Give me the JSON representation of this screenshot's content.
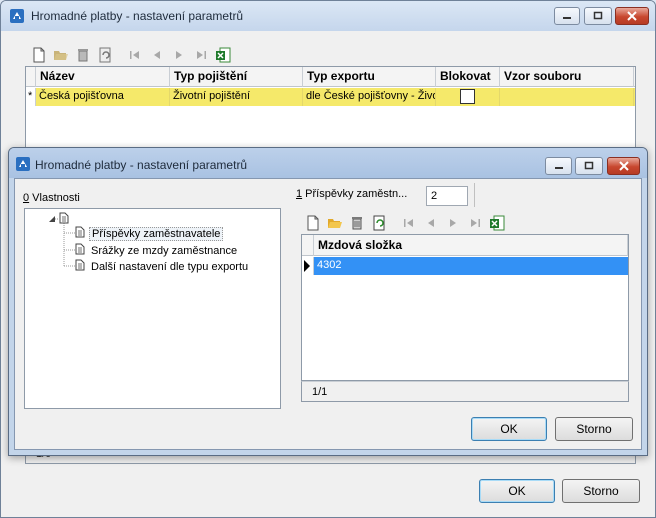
{
  "back_window": {
    "title": "Hromadné platby - nastavení parametrů",
    "grid": {
      "columns": [
        "Název",
        "Typ pojištění",
        "Typ exportu",
        "Blokovat",
        "Vzor souboru"
      ],
      "row_marker": "*",
      "rows": [
        {
          "nazev": "Česká pojišťovna",
          "typ_pojisteni": "Životní pojištění",
          "typ_exportu": "dle České pojišťovny - Živo",
          "blokovat": false,
          "vzor": ""
        }
      ]
    },
    "footer_counter": "1/0",
    "ok_label": "OK",
    "cancel_label": "Storno"
  },
  "front_window": {
    "title": "Hromadné platby - nastavení parametrů",
    "tree_header_hotkey": "0",
    "tree_header_label": " Vlastnosti",
    "tree_items": [
      "Příspěvky zaměstnavatele",
      "Srážky ze mzdy zaměstnance",
      "Další nastavení dle typu exportu"
    ],
    "tab_hotkey": "1",
    "tab_label": " Příspěvky zaměstn...",
    "tab_count_value": "2",
    "grid": {
      "column": "Mzdová složka",
      "rows": [
        "4302"
      ]
    },
    "counter": "1/1",
    "ok_label": "OK",
    "cancel_label": "Storno"
  },
  "colors": {
    "selected_row_yellow": "#f5e96a",
    "selected_row_blue": "#3391f5",
    "title_bar": "#c7d8ed"
  }
}
